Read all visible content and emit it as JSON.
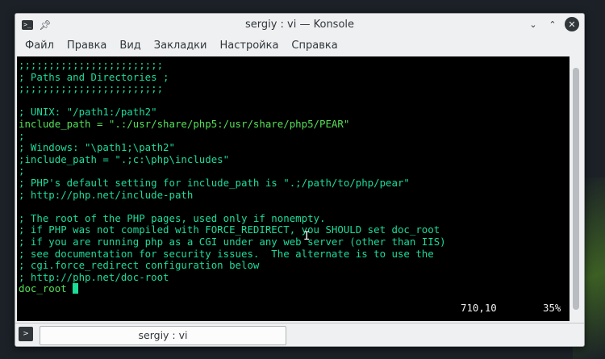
{
  "window": {
    "title": "sergiy : vi — Konsole",
    "pin_icon": "pin-icon",
    "buttons": {
      "minimize": "⌄",
      "maximize": "⌃",
      "close": "✕"
    }
  },
  "menu": [
    {
      "label": "Файл"
    },
    {
      "label": "Правка"
    },
    {
      "label": "Вид"
    },
    {
      "label": "Закладки"
    },
    {
      "label": "Настройка"
    },
    {
      "label": "Справка"
    }
  ],
  "terminal": {
    "lines": [
      {
        "text": ";;;;;;;;;;;;;;;;;;;;;;;;",
        "color": "cyan"
      },
      {
        "text": "; Paths and Directories ;",
        "color": "cyan"
      },
      {
        "text": ";;;;;;;;;;;;;;;;;;;;;;;;",
        "color": "cyan"
      },
      {
        "text": "",
        "color": "cyan"
      },
      {
        "text": "; UNIX: \"/path1:/path2\"",
        "color": "cyan"
      },
      {
        "text": "include_path = \".:/usr/share/php5:/usr/share/php5/PEAR\"",
        "color": "green"
      },
      {
        "text": ";",
        "color": "cyan"
      },
      {
        "text": "; Windows: \"\\path1;\\path2\"",
        "color": "cyan"
      },
      {
        "text": ";include_path = \".;c:\\php\\includes\"",
        "color": "cyan"
      },
      {
        "text": ";",
        "color": "cyan"
      },
      {
        "text": "; PHP's default setting for include_path is \".;/path/to/php/pear\"",
        "color": "cyan"
      },
      {
        "text": "; http://php.net/include-path",
        "color": "cyan"
      },
      {
        "text": "",
        "color": "cyan"
      },
      {
        "text": "; The root of the PHP pages, used only if nonempty.",
        "color": "cyan"
      },
      {
        "text": "; if PHP was not compiled with FORCE_REDIRECT, you SHOULD set doc_root",
        "color": "cyan"
      },
      {
        "text": "; if you are running php as a CGI under any web server (other than IIS)",
        "color": "cyan"
      },
      {
        "text": "; see documentation for security issues.  The alternate is to use the",
        "color": "cyan"
      },
      {
        "text": "; cgi.force_redirect configuration below",
        "color": "cyan"
      },
      {
        "text": "; http://php.net/doc-root",
        "color": "cyan"
      },
      {
        "text": "doc_root ",
        "color": "green",
        "cursor": true
      }
    ],
    "status_position": "710,10",
    "status_percent": "35%"
  },
  "tabs": [
    {
      "label": "sergiy : vi",
      "active": true
    }
  ],
  "colors": {
    "comment": "#1cdc9a",
    "directive": "#53e057",
    "background": "#000000"
  }
}
